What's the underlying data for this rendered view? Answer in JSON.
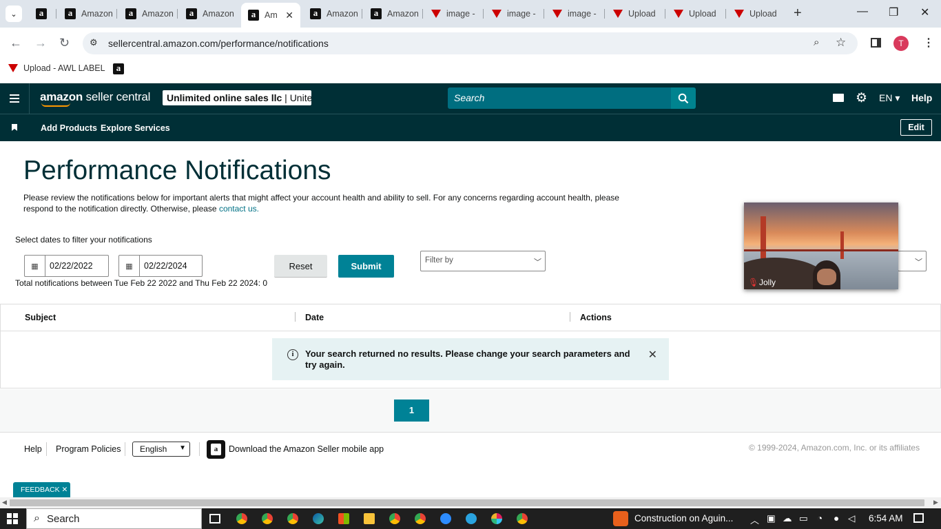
{
  "browser": {
    "tabs": [
      {
        "label": "",
        "icon": "amazon-icon"
      },
      {
        "label": "Amazon",
        "icon": "amazon-icon"
      },
      {
        "label": "Amazon",
        "icon": "amazon-icon"
      },
      {
        "label": "Amazon",
        "icon": "amazon-icon"
      },
      {
        "label": "Am",
        "icon": "amazon-icon",
        "active": true
      },
      {
        "label": "Amazon",
        "icon": "amazon-icon"
      },
      {
        "label": "Amazon",
        "icon": "amazon-icon"
      },
      {
        "label": "image -",
        "icon": "awl-label-icon"
      },
      {
        "label": "image -",
        "icon": "awl-label-icon"
      },
      {
        "label": "image -",
        "icon": "awl-label-icon"
      },
      {
        "label": "Upload",
        "icon": "awl-label-icon"
      },
      {
        "label": "Upload",
        "icon": "awl-label-icon"
      },
      {
        "label": "Upload",
        "icon": "awl-label-icon"
      }
    ],
    "url": "sellercentral.amazon.com/performance/notifications",
    "profile_initial": "T",
    "bookmarks": [
      {
        "label": "Upload - AWL LABEL",
        "icon": "awl-label-icon"
      },
      {
        "label": "",
        "icon": "amazon-icon"
      }
    ]
  },
  "header": {
    "logo_word1": "amazon",
    "logo_word2": " seller central",
    "account": "Unlimited online sales llc",
    "account_suffix": " | Unite…",
    "search_placeholder": "Search",
    "language": "EN",
    "help": "Help"
  },
  "nav": {
    "links": [
      "Add Products",
      "Explore Services"
    ],
    "edit": "Edit"
  },
  "page": {
    "title": "Performance Notifications",
    "description": "Please review the notifications below for important alerts that might affect your account health and ability to sell. For any concerns regarding account health, please respond to the notification directly. Otherwise, please ",
    "contact_link": "contact us.",
    "filter_label": "Select dates to filter your notifications",
    "start_date": "02/22/2022",
    "end_date": "02/22/2024",
    "reset": "Reset",
    "submit": "Submit",
    "filter_by": "Filter by",
    "total": "Total notifications between Tue Feb 22 2022 and Thu Feb 22 2024: 0"
  },
  "table": {
    "columns": [
      "Subject",
      "Date",
      "Actions"
    ],
    "empty_message": "Your search returned no results. Please change your search parameters and try again."
  },
  "pager": {
    "current": "1"
  },
  "footer": {
    "help": "Help",
    "policies": "Program Policies",
    "language": "English",
    "app_text": "Download the Amazon Seller mobile app",
    "copyright": "© 1999-2024, Amazon.com, Inc. or its affiliates",
    "feedback": "FEEDBACK"
  },
  "video_overlay": {
    "name": "Jolly"
  },
  "taskbar": {
    "search": "Search",
    "news": "Construction on Aguin...",
    "time": "6:54 AM"
  },
  "colors": {
    "header_bg": "#002f36",
    "accent": "#008296",
    "alert_bg": "#e6f2f3"
  }
}
